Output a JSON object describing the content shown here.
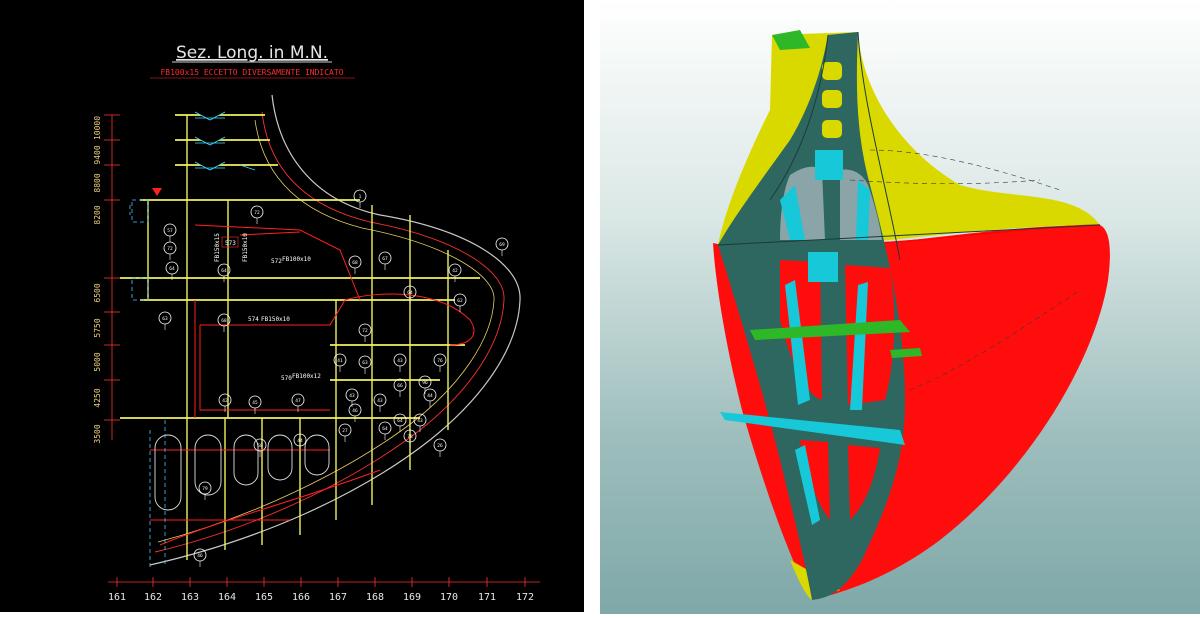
{
  "drawing": {
    "title": "Sez. Long. in M.N.",
    "subtitle": "FB100x15 ECCETTO DIVERSAMENTE INDICATO",
    "level_labels": [
      "10000",
      "9400",
      "8800",
      "8200",
      "6500",
      "5750",
      "5000",
      "4250",
      "3500"
    ],
    "frame_numbers": [
      "161",
      "162",
      "163",
      "164",
      "165",
      "166",
      "167",
      "168",
      "169",
      "170",
      "171",
      "172"
    ],
    "annotations": [
      "573",
      "FB150x15",
      "FB100x10",
      "572",
      "FB150x10",
      "574",
      "FB150x10",
      "570",
      "FB100x12"
    ],
    "detail_tags": [
      "72",
      "72",
      "64",
      "64",
      "68",
      "67",
      "64",
      "42",
      "69",
      "62",
      "63",
      "68",
      "72",
      "63",
      "43",
      "76",
      "43",
      "43",
      "66",
      "96",
      "44",
      "42",
      "45",
      "47",
      "1",
      "64",
      "43",
      "26",
      "79",
      "46",
      "27",
      "78",
      "44",
      "58",
      "57",
      "41",
      "64",
      "46"
    ]
  },
  "model": {
    "colors": {
      "shell_lower": "#ff0d0d",
      "shell_upper": "#d9d900",
      "structure": "#2e6660",
      "stiffeners": "#16c8d8",
      "deck_plates": "#2eb828"
    }
  }
}
